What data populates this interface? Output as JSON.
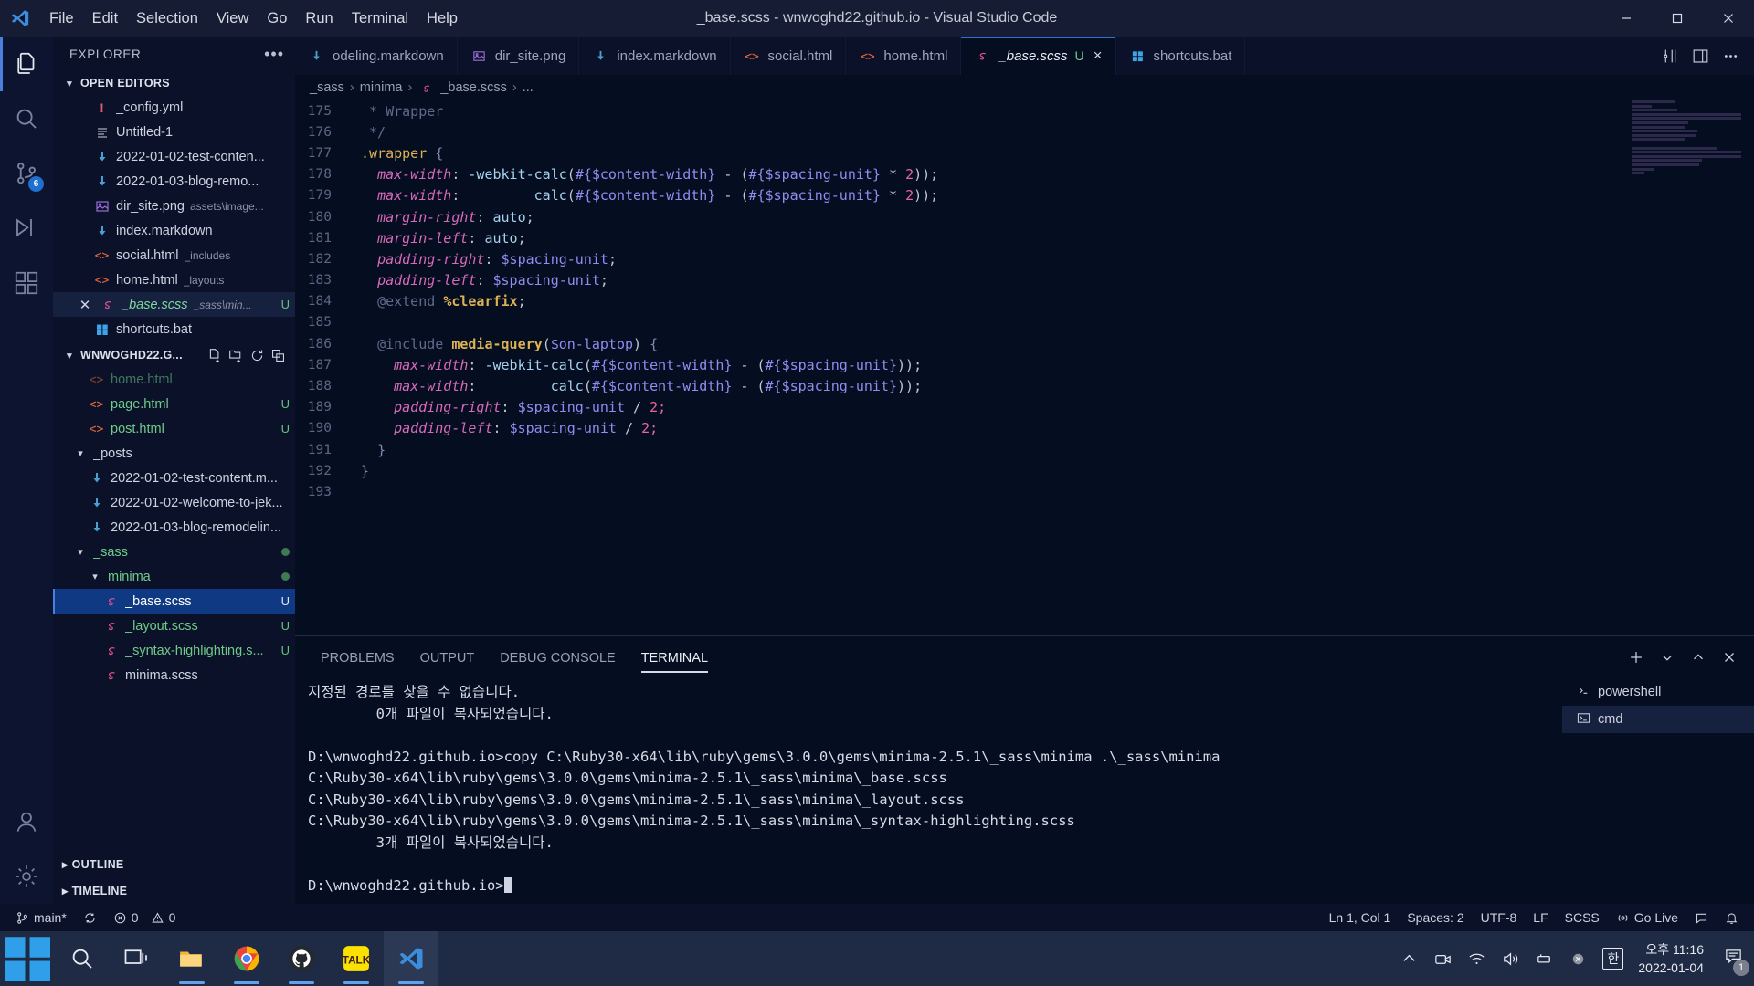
{
  "titlebar": {
    "menus": [
      "File",
      "Edit",
      "Selection",
      "View",
      "Go",
      "Run",
      "Terminal",
      "Help"
    ],
    "window_title": "_base.scss - wnwoghd22.github.io - Visual Studio Code"
  },
  "activitybar": {
    "items": [
      {
        "name": "explorer",
        "icon": "files-icon",
        "active": true,
        "badge": ""
      },
      {
        "name": "search",
        "icon": "search-icon",
        "active": false,
        "badge": ""
      },
      {
        "name": "source-control",
        "icon": "source-control-icon",
        "active": false,
        "badge": "6"
      },
      {
        "name": "run-debug",
        "icon": "run-debug-icon",
        "active": false,
        "badge": ""
      },
      {
        "name": "extensions",
        "icon": "extensions-icon",
        "active": false,
        "badge": ""
      },
      {
        "name": "accounts",
        "icon": "account-icon",
        "active": false,
        "badge": ""
      },
      {
        "name": "settings",
        "icon": "gear-icon",
        "active": false,
        "badge": ""
      }
    ]
  },
  "sidebar": {
    "title": "EXPLORER",
    "more_label": "•••",
    "open_editors": {
      "label": "OPEN EDITORS",
      "items": [
        {
          "name": "_config.yml",
          "desc": "",
          "icon": "yaml-icon",
          "badge": "",
          "active": false
        },
        {
          "name": "Untitled-1",
          "desc": "",
          "icon": "text-icon",
          "badge": "",
          "active": false
        },
        {
          "name": "2022-01-02-test-conten...",
          "desc": "",
          "icon": "markdown-icon",
          "badge": "",
          "active": false
        },
        {
          "name": "2022-01-03-blog-remo...",
          "desc": "",
          "icon": "markdown-icon",
          "badge": "",
          "active": false
        },
        {
          "name": "dir_site.png",
          "desc": "assets\\image...",
          "icon": "image-icon",
          "badge": "",
          "active": false
        },
        {
          "name": "index.markdown",
          "desc": "",
          "icon": "markdown-icon",
          "badge": "",
          "active": false
        },
        {
          "name": "social.html",
          "desc": "_includes",
          "icon": "html-icon",
          "badge": "",
          "active": false
        },
        {
          "name": "home.html",
          "desc": "_layouts",
          "icon": "html-icon",
          "badge": "",
          "active": false
        },
        {
          "name": "_base.scss",
          "desc": "_sass\\min...",
          "icon": "sass-icon",
          "badge": "U",
          "active": true
        },
        {
          "name": "shortcuts.bat",
          "desc": "",
          "icon": "bat-icon",
          "badge": "",
          "active": false
        }
      ]
    },
    "workspace": {
      "label": "WNWOGHD22.G...",
      "actions": [
        "new-file-icon",
        "new-folder-icon",
        "refresh-icon",
        "collapse-all-icon"
      ],
      "items": [
        {
          "name": "home.html",
          "indent": 2,
          "icon": "html-icon",
          "badge": "",
          "kind": "file",
          "color": "green",
          "cut": true
        },
        {
          "name": "page.html",
          "indent": 2,
          "icon": "html-icon",
          "badge": "U",
          "kind": "file",
          "color": "green"
        },
        {
          "name": "post.html",
          "indent": 2,
          "icon": "html-icon",
          "badge": "U",
          "kind": "file",
          "color": "green"
        },
        {
          "name": "_posts",
          "indent": 1,
          "icon": "",
          "badge": "",
          "kind": "folder-open",
          "color": "default"
        },
        {
          "name": "2022-01-02-test-content.m...",
          "indent": 2,
          "icon": "markdown-icon",
          "badge": "",
          "kind": "file",
          "color": "default"
        },
        {
          "name": "2022-01-02-welcome-to-jek...",
          "indent": 2,
          "icon": "markdown-icon",
          "badge": "",
          "kind": "file",
          "color": "default"
        },
        {
          "name": "2022-01-03-blog-remodelin...",
          "indent": 2,
          "icon": "markdown-icon",
          "badge": "",
          "kind": "file",
          "color": "default"
        },
        {
          "name": "_sass",
          "indent": 1,
          "icon": "",
          "badge": "●",
          "kind": "folder-open",
          "color": "green"
        },
        {
          "name": "minima",
          "indent": 2,
          "icon": "",
          "badge": "●",
          "kind": "folder-open",
          "color": "green"
        },
        {
          "name": "_base.scss",
          "indent": 3,
          "icon": "sass-icon",
          "badge": "U",
          "kind": "file",
          "color": "selected",
          "selected": true
        },
        {
          "name": "_layout.scss",
          "indent": 3,
          "icon": "sass-icon",
          "badge": "U",
          "kind": "file",
          "color": "green"
        },
        {
          "name": "_syntax-highlighting.s...",
          "indent": 3,
          "icon": "sass-icon",
          "badge": "U",
          "kind": "file",
          "color": "green"
        },
        {
          "name": "minima.scss",
          "indent": 3,
          "icon": "sass-icon",
          "badge": "",
          "kind": "file",
          "color": "default"
        }
      ]
    },
    "outline_label": "OUTLINE",
    "timeline_label": "TIMELINE"
  },
  "tabs": {
    "items": [
      {
        "name": "odeling.markdown",
        "icon": "markdown-icon",
        "active": false,
        "badge": "",
        "clipped": true
      },
      {
        "name": "dir_site.png",
        "icon": "image-icon",
        "active": false,
        "badge": ""
      },
      {
        "name": "index.markdown",
        "icon": "markdown-icon",
        "active": false,
        "badge": ""
      },
      {
        "name": "social.html",
        "icon": "html-icon",
        "active": false,
        "badge": ""
      },
      {
        "name": "home.html",
        "icon": "html-icon",
        "active": false,
        "badge": ""
      },
      {
        "name": "_base.scss",
        "icon": "sass-icon",
        "active": true,
        "badge": "U",
        "close": "×"
      },
      {
        "name": "shortcuts.bat",
        "icon": "bat-icon",
        "active": false,
        "badge": ""
      }
    ],
    "actions": [
      "split-editor-icon",
      "layout-icon",
      "more-actions-icon"
    ]
  },
  "breadcrumbs": {
    "parts": [
      "_sass",
      "minima",
      "_base.scss",
      "..."
    ]
  },
  "code": {
    "first_line_number": 175,
    "lines": [
      {
        "n": 175,
        "tokens": [
          {
            "t": " * Wrapper",
            "c": "comment"
          }
        ]
      },
      {
        "n": 176,
        "tokens": [
          {
            "t": " */",
            "c": "comment"
          }
        ]
      },
      {
        "n": 177,
        "tokens": [
          {
            "t": ".wrapper",
            "c": "sel"
          },
          {
            "t": " {",
            "c": "brace"
          }
        ]
      },
      {
        "n": 178,
        "tokens": [
          {
            "t": "  ",
            "c": "plain"
          },
          {
            "t": "max-width",
            "c": "prop"
          },
          {
            "t": ": ",
            "c": "punc"
          },
          {
            "t": "-webkit-calc",
            "c": "val"
          },
          {
            "t": "(",
            "c": "punc"
          },
          {
            "t": "#{$content-width}",
            "c": "var"
          },
          {
            "t": " - ",
            "c": "punc"
          },
          {
            "t": "(",
            "c": "punc"
          },
          {
            "t": "#{$spacing-unit}",
            "c": "var"
          },
          {
            "t": " * ",
            "c": "punc"
          },
          {
            "t": "2",
            "c": "num"
          },
          {
            "t": "));",
            "c": "punc"
          }
        ]
      },
      {
        "n": 179,
        "tokens": [
          {
            "t": "  ",
            "c": "plain"
          },
          {
            "t": "max-width",
            "c": "prop"
          },
          {
            "t": ":         ",
            "c": "punc"
          },
          {
            "t": "calc",
            "c": "val"
          },
          {
            "t": "(",
            "c": "punc"
          },
          {
            "t": "#{$content-width}",
            "c": "var"
          },
          {
            "t": " - ",
            "c": "punc"
          },
          {
            "t": "(",
            "c": "punc"
          },
          {
            "t": "#{$spacing-unit}",
            "c": "var"
          },
          {
            "t": " * ",
            "c": "punc"
          },
          {
            "t": "2",
            "c": "num"
          },
          {
            "t": "));",
            "c": "punc"
          }
        ]
      },
      {
        "n": 180,
        "tokens": [
          {
            "t": "  ",
            "c": "plain"
          },
          {
            "t": "margin-right",
            "c": "prop"
          },
          {
            "t": ": ",
            "c": "punc"
          },
          {
            "t": "auto",
            "c": "val"
          },
          {
            "t": ";",
            "c": "punc"
          }
        ]
      },
      {
        "n": 181,
        "tokens": [
          {
            "t": "  ",
            "c": "plain"
          },
          {
            "t": "margin-left",
            "c": "prop"
          },
          {
            "t": ": ",
            "c": "punc"
          },
          {
            "t": "auto",
            "c": "val"
          },
          {
            "t": ";",
            "c": "punc"
          }
        ]
      },
      {
        "n": 182,
        "tokens": [
          {
            "t": "  ",
            "c": "plain"
          },
          {
            "t": "padding-right",
            "c": "prop"
          },
          {
            "t": ": ",
            "c": "punc"
          },
          {
            "t": "$spacing-unit",
            "c": "var"
          },
          {
            "t": ";",
            "c": "punc"
          }
        ]
      },
      {
        "n": 183,
        "tokens": [
          {
            "t": "  ",
            "c": "plain"
          },
          {
            "t": "padding-left",
            "c": "prop"
          },
          {
            "t": ": ",
            "c": "punc"
          },
          {
            "t": "$spacing-unit",
            "c": "var"
          },
          {
            "t": ";",
            "c": "punc"
          }
        ]
      },
      {
        "n": 184,
        "tokens": [
          {
            "t": "  ",
            "c": "plain"
          },
          {
            "t": "@extend",
            "c": "at"
          },
          {
            "t": " ",
            "c": "plain"
          },
          {
            "t": "%clearfix",
            "c": "kw"
          },
          {
            "t": ";",
            "c": "punc"
          }
        ]
      },
      {
        "n": 185,
        "tokens": []
      },
      {
        "n": 186,
        "tokens": [
          {
            "t": "  ",
            "c": "plain"
          },
          {
            "t": "@include",
            "c": "at"
          },
          {
            "t": " ",
            "c": "plain"
          },
          {
            "t": "media-query",
            "c": "kw"
          },
          {
            "t": "(",
            "c": "punc"
          },
          {
            "t": "$on-laptop",
            "c": "var"
          },
          {
            "t": ") ",
            "c": "punc"
          },
          {
            "t": "{",
            "c": "brace"
          }
        ]
      },
      {
        "n": 187,
        "tokens": [
          {
            "t": "    ",
            "c": "plain"
          },
          {
            "t": "max-width",
            "c": "prop"
          },
          {
            "t": ": ",
            "c": "punc"
          },
          {
            "t": "-webkit-calc",
            "c": "val"
          },
          {
            "t": "(",
            "c": "punc"
          },
          {
            "t": "#{$content-width}",
            "c": "var"
          },
          {
            "t": " - ",
            "c": "punc"
          },
          {
            "t": "(",
            "c": "punc"
          },
          {
            "t": "#{$spacing-unit}",
            "c": "var"
          },
          {
            "t": "));",
            "c": "punc"
          }
        ]
      },
      {
        "n": 188,
        "tokens": [
          {
            "t": "    ",
            "c": "plain"
          },
          {
            "t": "max-width",
            "c": "prop"
          },
          {
            "t": ":         ",
            "c": "punc"
          },
          {
            "t": "calc",
            "c": "val"
          },
          {
            "t": "(",
            "c": "punc"
          },
          {
            "t": "#{$content-width}",
            "c": "var"
          },
          {
            "t": " - ",
            "c": "punc"
          },
          {
            "t": "(",
            "c": "punc"
          },
          {
            "t": "#{$spacing-unit}",
            "c": "var"
          },
          {
            "t": "));",
            "c": "punc"
          }
        ]
      },
      {
        "n": 189,
        "tokens": [
          {
            "t": "    ",
            "c": "plain"
          },
          {
            "t": "padding-right",
            "c": "prop"
          },
          {
            "t": ": ",
            "c": "punc"
          },
          {
            "t": "$spacing-unit",
            "c": "var"
          },
          {
            "t": " / ",
            "c": "punc"
          },
          {
            "t": "2",
            "c": "num"
          },
          {
            "t": ";",
            "c": "num"
          }
        ]
      },
      {
        "n": 190,
        "tokens": [
          {
            "t": "    ",
            "c": "plain"
          },
          {
            "t": "padding-left",
            "c": "prop"
          },
          {
            "t": ": ",
            "c": "punc"
          },
          {
            "t": "$spacing-unit",
            "c": "var"
          },
          {
            "t": " / ",
            "c": "punc"
          },
          {
            "t": "2",
            "c": "num"
          },
          {
            "t": ";",
            "c": "num"
          }
        ]
      },
      {
        "n": 191,
        "tokens": [
          {
            "t": "  ",
            "c": "plain"
          },
          {
            "t": "}",
            "c": "brace"
          }
        ]
      },
      {
        "n": 192,
        "tokens": [
          {
            "t": "}",
            "c": "brace"
          }
        ]
      },
      {
        "n": 193,
        "tokens": []
      }
    ]
  },
  "panel": {
    "tabs": [
      {
        "label": "PROBLEMS",
        "active": false
      },
      {
        "label": "OUTPUT",
        "active": false
      },
      {
        "label": "DEBUG CONSOLE",
        "active": false
      },
      {
        "label": "TERMINAL",
        "active": true
      }
    ],
    "actions": [
      "new-terminal-icon",
      "chevron-down-icon",
      "chevron-up-icon",
      "close-icon"
    ],
    "terminal_output": [
      "지정된 경로를 찾을 수 없습니다.",
      "        0개 파일이 복사되었습니다.",
      "",
      "D:\\wnwoghd22.github.io>copy C:\\Ruby30-x64\\lib\\ruby\\gems\\3.0.0\\gems\\minima-2.5.1\\_sass\\minima .\\_sass\\minima",
      "C:\\Ruby30-x64\\lib\\ruby\\gems\\3.0.0\\gems\\minima-2.5.1\\_sass\\minima\\_base.scss",
      "C:\\Ruby30-x64\\lib\\ruby\\gems\\3.0.0\\gems\\minima-2.5.1\\_sass\\minima\\_layout.scss",
      "C:\\Ruby30-x64\\lib\\ruby\\gems\\3.0.0\\gems\\minima-2.5.1\\_sass\\minima\\_syntax-highlighting.scss",
      "        3개 파일이 복사되었습니다.",
      "",
      "D:\\wnwoghd22.github.io>"
    ],
    "terminal_instances": [
      {
        "label": "powershell",
        "icon": "terminal-powershell-icon",
        "active": false
      },
      {
        "label": "cmd",
        "icon": "terminal-cmd-icon",
        "active": true
      }
    ]
  },
  "statusbar": {
    "left": [
      {
        "label": "main*",
        "icon": "source-control-icon",
        "name": "branch-indicator"
      },
      {
        "label": "",
        "icon": "sync-icon",
        "name": "sync-button"
      },
      {
        "label": "0",
        "icon": "error-icon",
        "name": "error-count"
      },
      {
        "label": "0",
        "icon": "warning-icon",
        "name": "warning-count"
      }
    ],
    "right": [
      {
        "label": "Ln 1, Col 1",
        "name": "cursor-position"
      },
      {
        "label": "Spaces: 2",
        "name": "indentation"
      },
      {
        "label": "UTF-8",
        "name": "encoding"
      },
      {
        "label": "LF",
        "name": "eol"
      },
      {
        "label": "SCSS",
        "name": "language-mode"
      },
      {
        "label": "Go Live",
        "icon": "broadcast-icon",
        "name": "go-live"
      },
      {
        "label": "",
        "icon": "feedback-icon",
        "name": "feedback"
      },
      {
        "label": "",
        "icon": "bell-icon",
        "name": "notifications"
      }
    ]
  },
  "taskbar": {
    "start_label": "Start",
    "items": [
      {
        "name": "start-button",
        "icon": "windows-icon"
      },
      {
        "name": "search-button",
        "icon": "search-icon"
      },
      {
        "name": "task-view-button",
        "icon": "task-view-icon"
      },
      {
        "name": "file-explorer",
        "icon": "folder-icon",
        "running": true
      },
      {
        "name": "chrome",
        "icon": "chrome-icon",
        "running": true
      },
      {
        "name": "github-desktop",
        "icon": "github-icon",
        "running": true
      },
      {
        "name": "kakaotalk",
        "icon": "talk-icon",
        "running": true
      },
      {
        "name": "vscode",
        "icon": "vscode-icon",
        "running": true,
        "active": true
      }
    ],
    "tray": [
      {
        "name": "show-hidden-icons",
        "icon": "chevron-up-icon"
      },
      {
        "name": "camera-icon",
        "icon": "camera-icon"
      },
      {
        "name": "wifi-icon",
        "icon": "wifi-icon"
      },
      {
        "name": "volume-icon",
        "icon": "volume-icon"
      },
      {
        "name": "battery-icon",
        "icon": "battery-icon"
      },
      {
        "name": "safely-remove-icon",
        "icon": "eject-icon"
      }
    ],
    "ime": "한",
    "time": "오후 11:16",
    "date": "2022-01-04",
    "notification_count": "1"
  },
  "colors": {
    "accent": "#2f6fd0",
    "selection": "#0f3a83",
    "sass_pink": "#e3518c",
    "html_orange": "#e8683c",
    "markdown_blue": "#4b9ecf",
    "green_text": "#6fca8a"
  }
}
